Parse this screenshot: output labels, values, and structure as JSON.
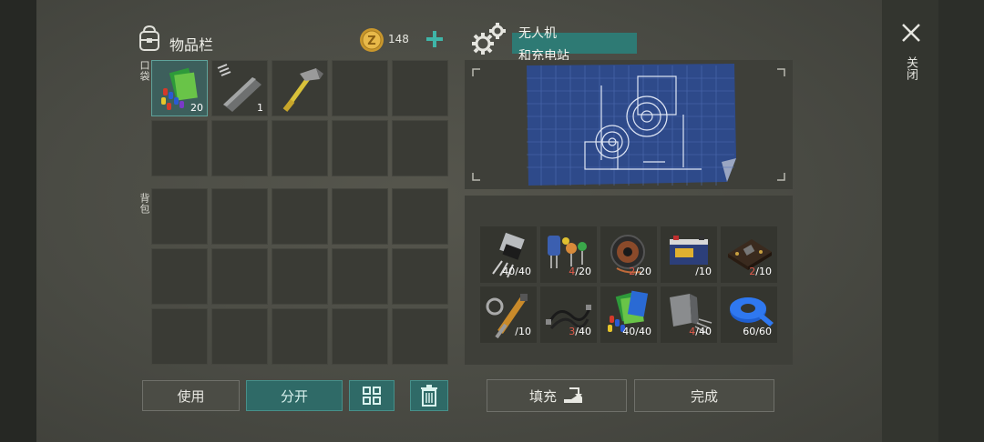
{
  "inventory": {
    "title": "物品栏",
    "coins": "148",
    "pocket_label": "口袋",
    "backpack_label": "背包",
    "pocket_items": [
      {
        "name": "circuit-parts",
        "count": "20"
      },
      {
        "name": "metal-bar",
        "count": "1"
      },
      {
        "name": "hammer",
        "count": ""
      }
    ]
  },
  "buttons": {
    "use": "使用",
    "split": "分开",
    "fill": "填充",
    "complete": "完成"
  },
  "craft": {
    "title_line1": "无人机",
    "title_line2": "和充电站"
  },
  "close_label": "关闭",
  "materials": [
    {
      "icon": "transistor-icon",
      "have": "40",
      "need": "40"
    },
    {
      "icon": "capacitor-icon",
      "have": "4",
      "need": "20"
    },
    {
      "icon": "wire-spool-icon",
      "have": "2",
      "need": "20"
    },
    {
      "icon": "battery-icon",
      "have": "",
      "need": "10"
    },
    {
      "icon": "circuit-board-icon",
      "have": "2",
      "need": "10"
    },
    {
      "icon": "hydraulic-parts-icon",
      "have": "",
      "need": "10"
    },
    {
      "icon": "cable-icon",
      "have": "3",
      "need": "40"
    },
    {
      "icon": "circuit-parts-icon",
      "have": "40",
      "need": "40"
    },
    {
      "icon": "metal-scrap-icon",
      "have": "4",
      "need": "40"
    },
    {
      "icon": "tape-icon",
      "have": "60",
      "need": "60"
    }
  ],
  "colors": {
    "accent": "#2f6a67",
    "missing": "#e05a4b"
  }
}
